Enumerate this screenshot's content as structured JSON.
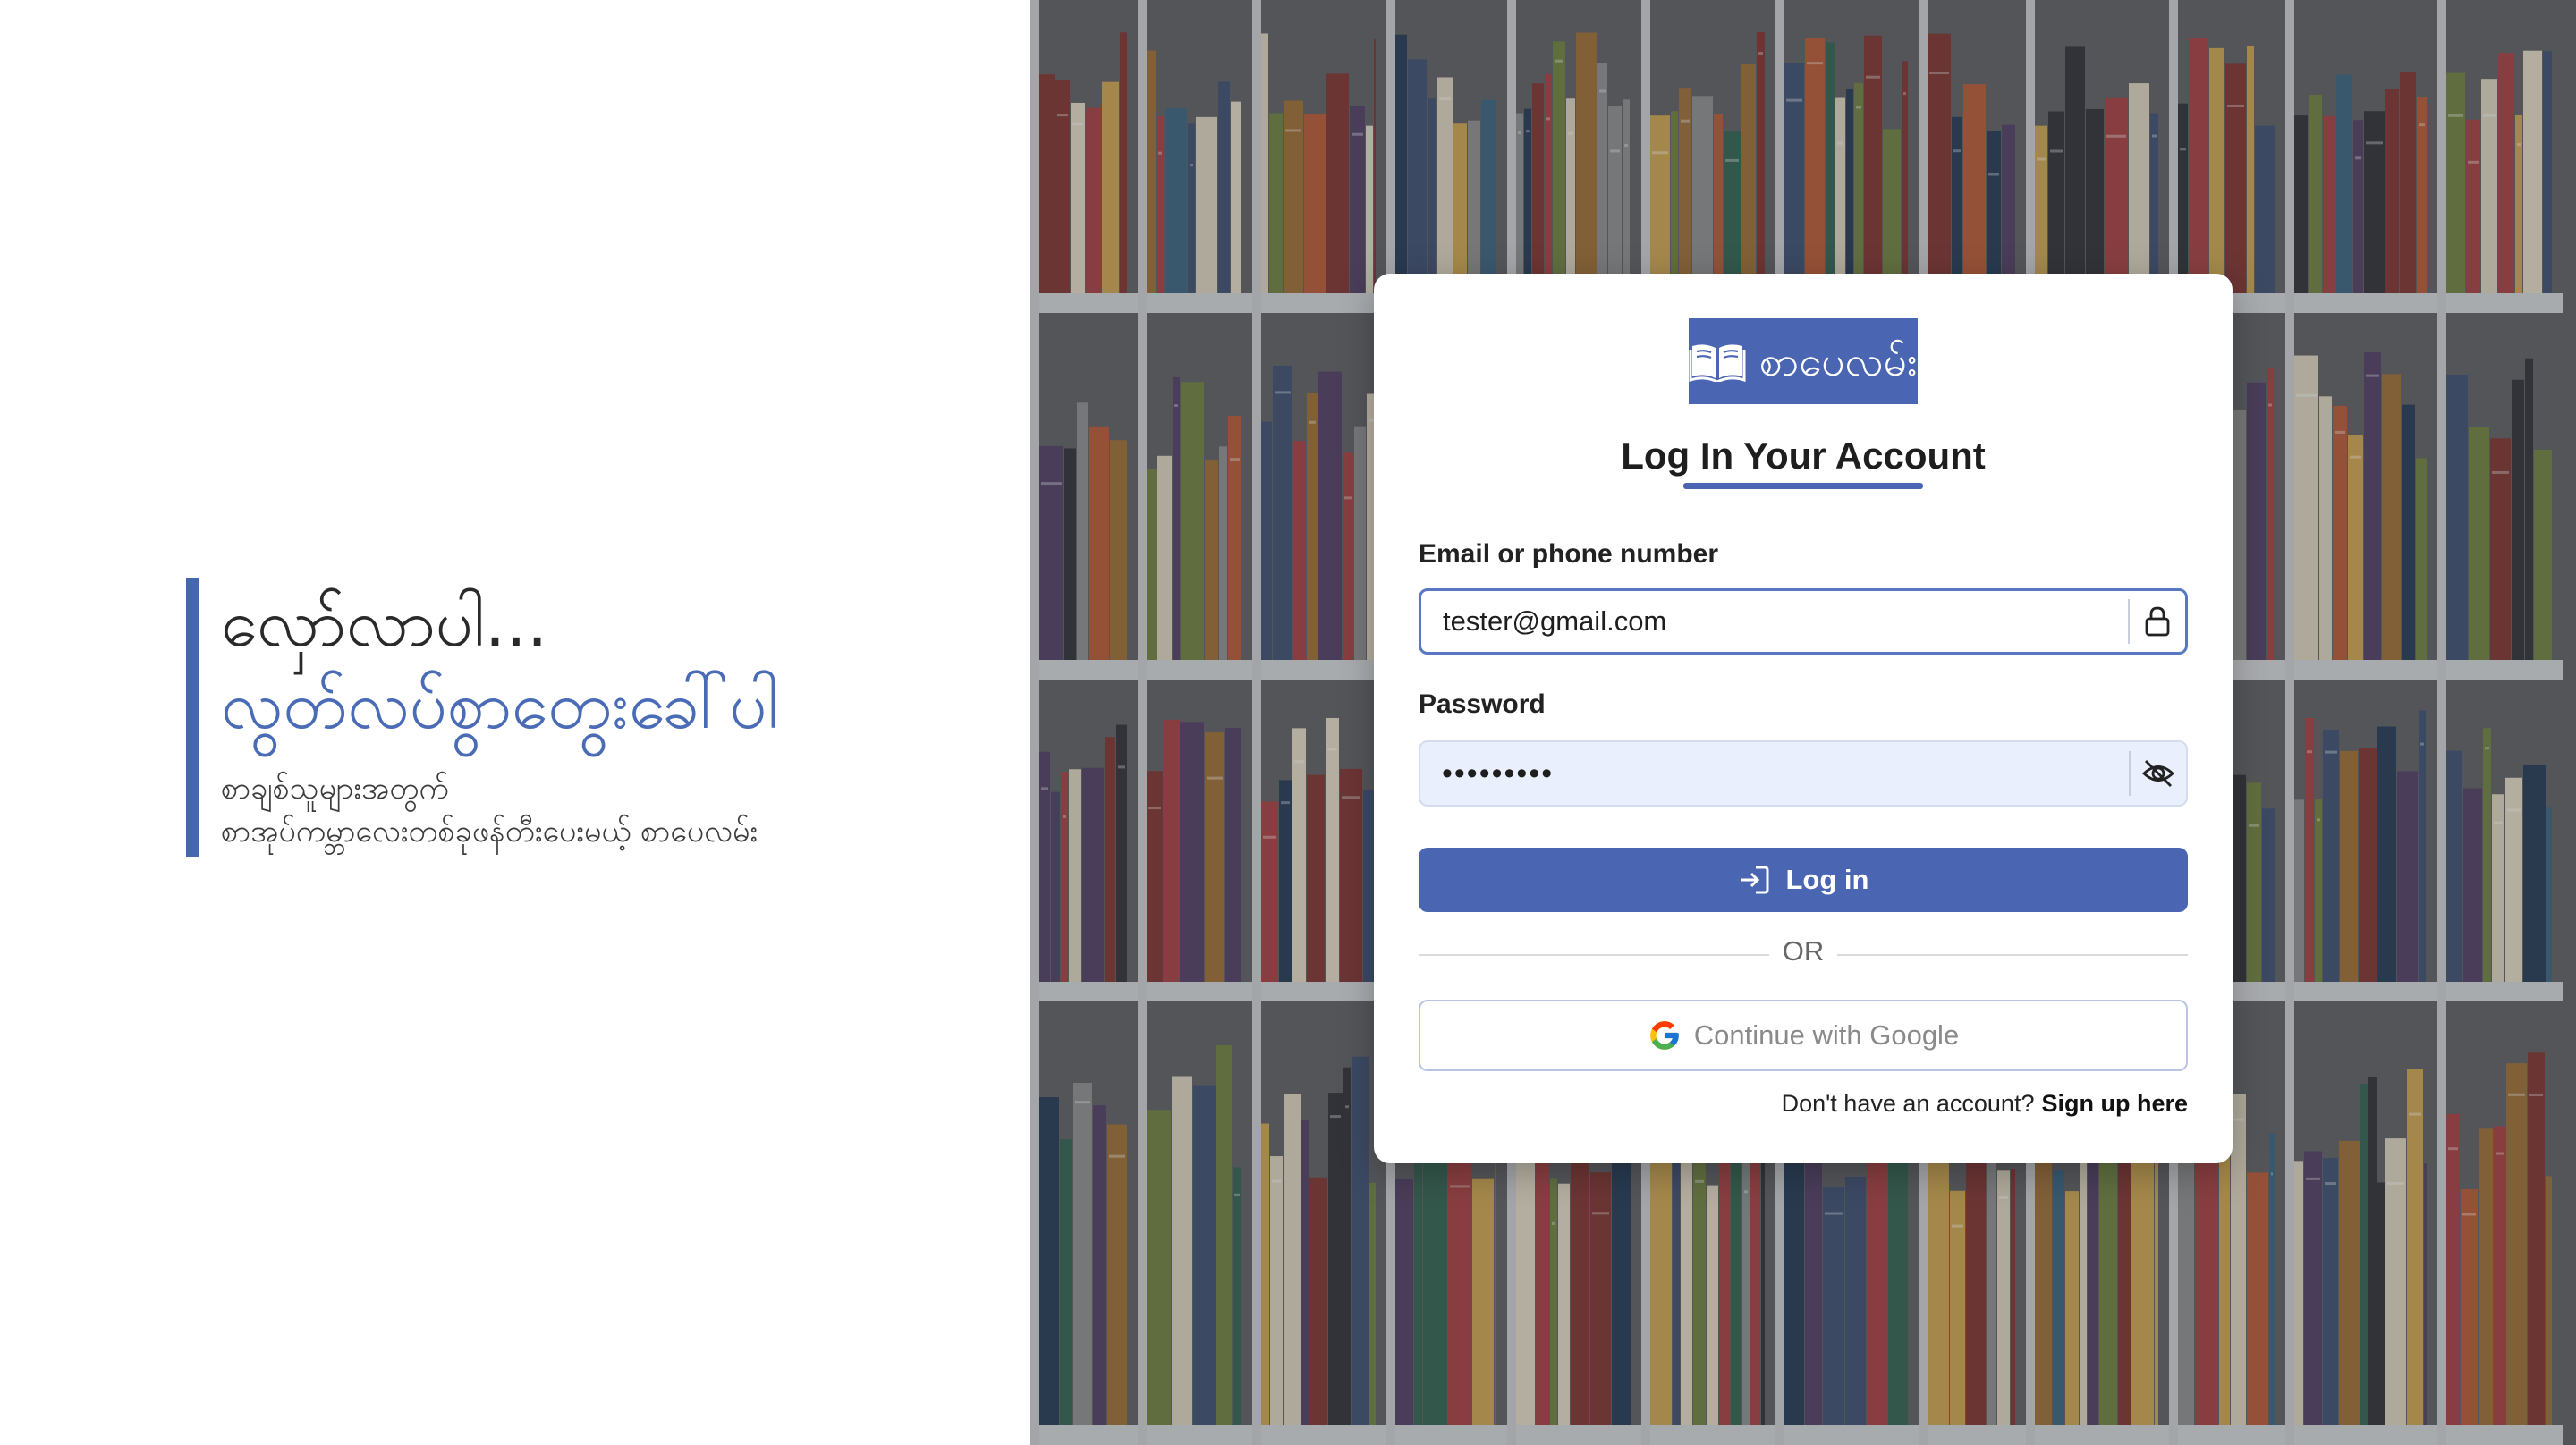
{
  "hero": {
    "line1": "လှော်လာပါ...",
    "line2": "လွတ်လပ်စွာတွေးခေါ်ပါ",
    "subtitle_line1": "စာချစ်သူများအတွက်",
    "subtitle_line2": "စာအုပ်ကမ္ဘာလေးတစ်ခုဖန်တီးပေးမယ့် စာပေလမ်း"
  },
  "brand": {
    "logo_text": "စာပေလမ်း",
    "icon": "open-book-icon",
    "accent_color": "#4a66b2"
  },
  "login_form": {
    "title": "Log In Your Account",
    "email_label": "Email or phone number",
    "email_value": "tester@gmail.com",
    "email_icon": "lock-icon",
    "password_label": "Password",
    "password_value": "password1",
    "password_icon": "eye-off-icon",
    "login_button_label": "Log in",
    "login_button_icon": "login-arrow-icon",
    "divider_text": "OR",
    "google_button_label": "Continue with Google",
    "google_icon": "google-icon",
    "signup_prompt": "Don't have an account?",
    "signup_link": "Sign up here"
  }
}
